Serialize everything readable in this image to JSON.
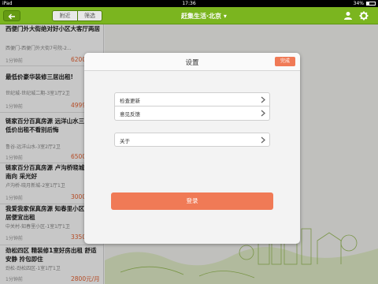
{
  "status_bar": {
    "device": "iPad",
    "time": "17:36",
    "battery": "34%",
    "battery_level": 0.34
  },
  "nav": {
    "back_icon": "back-arrow-icon",
    "tabs": [
      "附近",
      "筛选"
    ],
    "title": "赶集生活·北京 ▾",
    "right_icons": [
      "user-icon",
      "gear-icon"
    ],
    "accent": "#7bb51f"
  },
  "listings": [
    {
      "title": "西便门外大街绝对好小区大客厅两居",
      "location": "西便门-西便门外大街7号院-2...",
      "time": "1分钟前",
      "price": "6200"
    },
    {
      "title": "最低价豪华装修三居出租!",
      "location": "世纪城-世纪城二期-3室1厅2卫",
      "time": "1分钟前",
      "price": "4999"
    },
    {
      "title": "链家百分百真房源 远洋山水三居超低价出租不看别后悔",
      "location": "鲁谷-远洋山水-3室2厅2卫",
      "time": "1分钟前",
      "price": "6500"
    },
    {
      "title": "链家百分百真房源 卢沟桥晓城 精装南向 采光好",
      "location": "卢沟桥-晓月新城-2室1厅1卫",
      "time": "1分钟前",
      "price": "3000"
    },
    {
      "title": "我爱我家保真房源 知春里小区装一居便宜出租",
      "location": "中关村-知春里小区-1室1厅1卫",
      "time": "1分钟前",
      "price": "3350"
    },
    {
      "title": "劲松四区 精装修1室好房出租 舒适安静 拎包即住",
      "location": "劲松-劲松四区-1室1厅1卫",
      "time": "1分钟前",
      "price": "2800元/月"
    }
  ],
  "modal": {
    "title": "设置",
    "done_label": "完成",
    "items_group": [
      "检查更新",
      "意见反馈"
    ],
    "about_label": "关于",
    "login_label": "登录",
    "button_color": "#f07a56"
  }
}
